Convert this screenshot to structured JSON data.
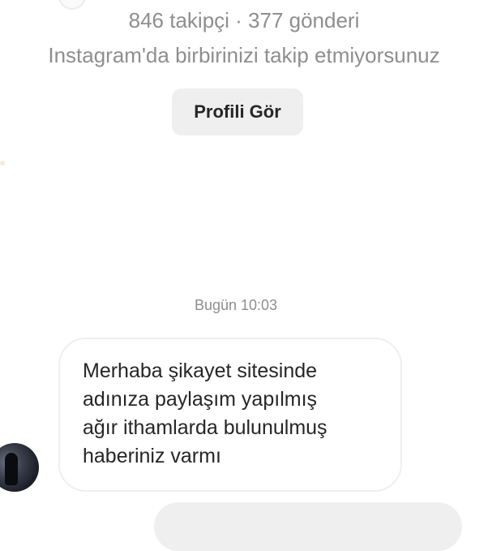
{
  "profile": {
    "stats": "846 takipçi · 377 gönderi",
    "follow_status": "Instagram'da birbirinizi takip etmiyorsunuz",
    "view_profile_label": "Profili Gör"
  },
  "conversation": {
    "timestamp": "Bugün 10:03",
    "messages": [
      {
        "direction": "incoming",
        "text": "Merhaba şikayet sitesinde\nadınıza paylaşım yapılmış\nağır ithamlarda bulunulmuş\nhaberiniz varmı"
      }
    ]
  },
  "colors": {
    "muted_text": "#8e8e8e",
    "primary_text": "#262626",
    "button_background": "#efefef",
    "bubble_border": "#efefef"
  }
}
